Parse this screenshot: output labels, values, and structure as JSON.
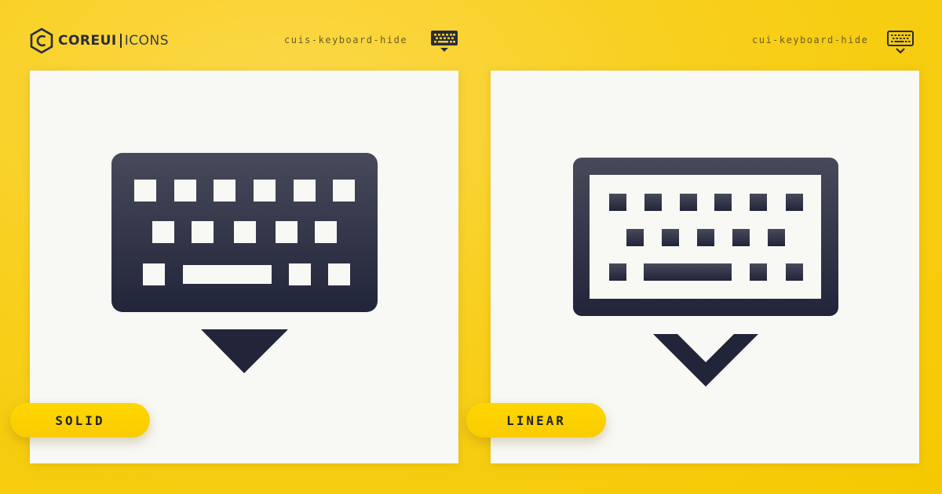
{
  "brand": {
    "core": "COREUI",
    "icons": "ICONS"
  },
  "solid": {
    "icon_name": "cuis-keyboard-hide",
    "label": "SOLID"
  },
  "linear": {
    "icon_name": "cui-keyboard-hide",
    "label": "LINEAR"
  },
  "colors": {
    "background": "#f8cf1c",
    "card": "#f8f8f4",
    "icon": "#2f3140",
    "pill": "#ffd600"
  },
  "icons": {
    "solid": "keyboard-hide-solid-icon",
    "linear": "keyboard-hide-linear-icon",
    "logo": "coreui-hexagon-logo-icon"
  }
}
